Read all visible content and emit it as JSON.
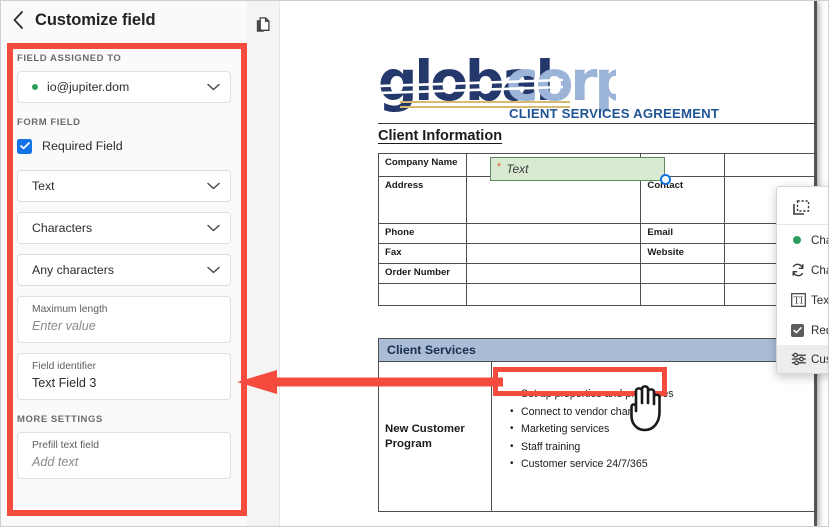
{
  "panel": {
    "title": "Customize field",
    "back_icon": "chevron-left-icon",
    "sections": {
      "assigned_label": "FIELD ASSIGNED TO",
      "assignee": "io@jupiter.dom",
      "form_field_label": "FORM FIELD",
      "required_checkbox_label": "Required Field",
      "required_checked": true,
      "field_type": "Text",
      "field_unit": "Characters",
      "field_rule": "Any characters",
      "max_length_label": "Maximum length",
      "max_length_placeholder": "Enter value",
      "identifier_label": "Field identifier",
      "identifier_value": "Text Field 3",
      "more_settings_label": "MORE SETTINGS",
      "prefill_label": "Prefill text field",
      "prefill_placeholder": "Add text"
    }
  },
  "page_strip": {
    "thumbnail_icon": "pages-copy-icon"
  },
  "document": {
    "logo_text_1": "global",
    "logo_text_2": "corp",
    "agreement_title": "CLIENT SERVICES AGREEMENT",
    "client_info_heading": "Client Information",
    "client_table": {
      "rows": [
        {
          "label": "Company Name",
          "right_label": ""
        },
        {
          "label": "Address",
          "right_label": "Contact"
        },
        {
          "label": "",
          "right_label": "Email"
        },
        {
          "label": "Phone",
          "right_label": "Website"
        },
        {
          "label": "Fax",
          "right_label": ""
        },
        {
          "label": "Order Number",
          "right_label": ""
        }
      ]
    },
    "services_table": {
      "header": "Client Services",
      "program_label": "New Customer Program",
      "bullets": [
        "Set up properties and processes",
        "Connect to vendor channels",
        "Marketing services",
        "Staff training",
        "Customer service 24/7/365"
      ]
    },
    "selected_field": {
      "required_marker": "*",
      "text": "Text"
    }
  },
  "context_menu": {
    "toolbar_icons": [
      {
        "name": "duplicate-field-icon"
      },
      {
        "name": "delete-field-icon"
      },
      {
        "name": "more-options-icon",
        "glyph": "•••"
      }
    ],
    "items": [
      {
        "label": "Change recipients",
        "icon": "recipient-dot-icon",
        "submenu": true
      },
      {
        "label": "Change field type",
        "icon": "refresh-icon",
        "submenu": true
      },
      {
        "label": "Text format",
        "icon": "text-format-icon",
        "submenu": true
      },
      {
        "label": "Required field",
        "icon": "checkbox-checked-icon",
        "submenu": false
      },
      {
        "label": "Customize field",
        "icon": "sliders-icon",
        "submenu": false,
        "highlighted": true
      }
    ]
  },
  "colors": {
    "annotation_red": "#f54b3e",
    "accent_blue": "#1473e6",
    "green_dot": "#2d9d5e",
    "field_green_fill": "#d9ead3",
    "services_header_blue": "#aabcd6",
    "logo_navy": "#24386b",
    "logo_lightblue": "#9db4d9",
    "logo_gold": "#d9b870"
  }
}
